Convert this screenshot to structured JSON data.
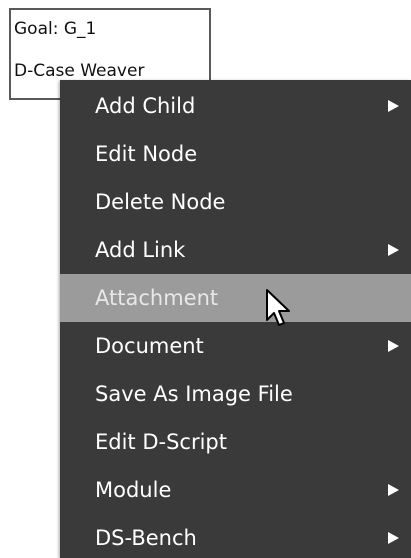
{
  "node": {
    "title": "Goal: G_1",
    "description": "D-Case Weaver"
  },
  "menu": {
    "items": [
      {
        "label": "Add Child",
        "has_submenu": true
      },
      {
        "label": "Edit Node",
        "has_submenu": false
      },
      {
        "label": "Delete Node",
        "has_submenu": false
      },
      {
        "label": "Add Link",
        "has_submenu": true
      },
      {
        "label": "Attachment",
        "has_submenu": false,
        "highlighted": true
      },
      {
        "label": "Document",
        "has_submenu": true
      },
      {
        "label": "Save As Image File",
        "has_submenu": false
      },
      {
        "label": "Edit D-Script",
        "has_submenu": false
      },
      {
        "label": "Module",
        "has_submenu": true
      },
      {
        "label": "DS-Bench",
        "has_submenu": true
      }
    ]
  },
  "colors": {
    "menu_background": "#3a3a3a",
    "menu_highlight": "#9b9b9b",
    "menu_text": "#ffffff",
    "node_border": "#5a5a5a"
  },
  "icons": {
    "submenu": "triangle-right-icon",
    "pointer": "mouse-pointer-icon"
  }
}
